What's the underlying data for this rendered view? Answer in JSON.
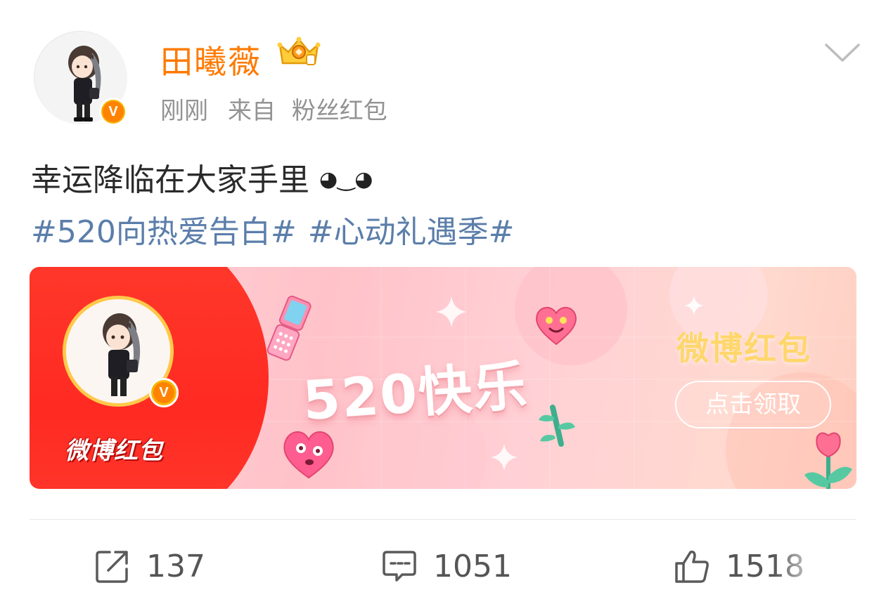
{
  "header": {
    "username": "田曦薇",
    "time": "刚刚",
    "source_prefix": "来自",
    "source": "粉丝红包",
    "verified_badge_text": "V"
  },
  "post": {
    "text": "幸运降临在大家手里",
    "emoji": "◕‿◕",
    "hashtags": [
      "#520向热爱告白#",
      "#心动礼遇季#"
    ]
  },
  "banner": {
    "logo_text": "微博红包",
    "title": "520快乐",
    "brand": "微博红包",
    "button_label": "点击领取"
  },
  "actions": {
    "repost_count": "137",
    "comment_count": "1051",
    "like_count": "1518"
  },
  "colors": {
    "username": "#ff7a00",
    "hashtag": "#5b7eaa",
    "banner_red": "#ff2a22",
    "brand_gold": "#ffd66b"
  },
  "icons": {
    "crown": "vip-crown-icon",
    "chevron": "chevron-down-icon",
    "repost": "repost-icon",
    "comment": "comment-icon",
    "like": "thumbs-up-icon"
  }
}
